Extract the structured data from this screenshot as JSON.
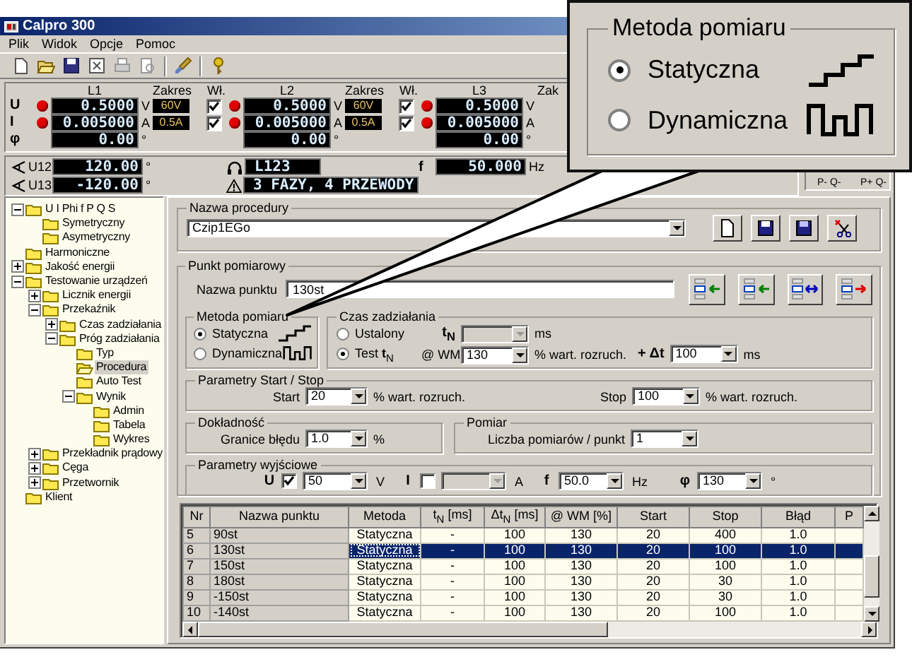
{
  "window": {
    "title": "Calpro 300"
  },
  "menu": [
    "Plik",
    "Widok",
    "Opcje",
    "Pomoc"
  ],
  "readings": {
    "row_labels": [
      "U",
      "I",
      "φ"
    ],
    "phases": [
      {
        "label": "L1",
        "range_heading": "Zakres",
        "enable_heading": "Wł.",
        "rows": [
          {
            "led": true,
            "value": "0.5000",
            "unit": "V",
            "range": "60V",
            "enabled": true
          },
          {
            "led": true,
            "value": "0.005000",
            "unit": "A",
            "range": "0.5A",
            "enabled": true
          },
          {
            "led": false,
            "value": "0.00",
            "unit": "°"
          }
        ]
      },
      {
        "label": "L2",
        "range_heading": "Zakres",
        "enable_heading": "Wł.",
        "rows": [
          {
            "led": true,
            "value": "0.5000",
            "unit": "V",
            "range": "60V",
            "enabled": true
          },
          {
            "led": true,
            "value": "0.005000",
            "unit": "A",
            "range": "0.5A",
            "enabled": true
          },
          {
            "led": false,
            "value": "0.00",
            "unit": "°"
          }
        ]
      },
      {
        "label": "L3",
        "range_heading": "Zak",
        "rows": [
          {
            "led": true,
            "value": "0.5000",
            "unit": "V"
          },
          {
            "led": true,
            "value": "0.005000",
            "unit": "A"
          },
          {
            "led": false,
            "value": "0.00",
            "unit": "°"
          }
        ]
      }
    ]
  },
  "angles": [
    {
      "label": "U12",
      "value": "120.00",
      "unit": "°"
    },
    {
      "label": "U13",
      "value": "-120.00",
      "unit": "°"
    }
  ],
  "sequence": {
    "value": "L123"
  },
  "wiring": {
    "value": "3 FAZY, 4 PRZEWODY"
  },
  "frequency": {
    "label": "f",
    "value": "50.000",
    "unit": "Hz"
  },
  "quadrants": [
    "P- Q-",
    "P+ Q-"
  ],
  "tree": [
    {
      "label": "U I Phi f P Q S",
      "expanded": true,
      "selected": false,
      "children": [
        {
          "label": "Symetryczny",
          "selected": false
        },
        {
          "label": "Asymetryczny",
          "selected": false
        }
      ]
    },
    {
      "label": "Harmoniczne",
      "selected": false
    },
    {
      "label": "Jakość energii",
      "expanded": false,
      "selected": false
    },
    {
      "label": "Testowanie urządzeń",
      "expanded": true,
      "selected": false,
      "children": [
        {
          "label": "Licznik energii",
          "expanded": false,
          "selected": false
        },
        {
          "label": "Przekaźnik",
          "expanded": true,
          "selected": false,
          "children": [
            {
              "label": "Czas zadziałania",
              "expanded": false,
              "selected": false
            },
            {
              "label": "Próg zadziałania",
              "expanded": true,
              "selected": false,
              "children": [
                {
                  "label": "Typ",
                  "selected": false
                },
                {
                  "label": "Procedura",
                  "selected": true
                },
                {
                  "label": "Auto Test",
                  "selected": false
                },
                {
                  "label": "Wynik",
                  "expanded": true,
                  "selected": false,
                  "children": [
                    {
                      "label": "Admin",
                      "selected": false
                    },
                    {
                      "label": "Tabela",
                      "selected": false
                    },
                    {
                      "label": "Wykres",
                      "selected": false
                    }
                  ]
                }
              ]
            }
          ]
        },
        {
          "label": "Przekładnik prądowy",
          "expanded": false,
          "selected": false
        },
        {
          "label": "Cęga",
          "expanded": false,
          "selected": false
        },
        {
          "label": "Przetwornik",
          "expanded": false,
          "selected": false
        }
      ]
    },
    {
      "label": "Klient",
      "selected": false
    }
  ],
  "procedure": {
    "title": "Nazwa procedury",
    "name": "Czip1EGo"
  },
  "point": {
    "title": "Punkt pomiarowy",
    "name_label": "Nazwa punktu",
    "name": "130st",
    "method": {
      "title": "Metoda pomiaru",
      "options": [
        {
          "label": "Statyczna",
          "kind": "static",
          "selected": true
        },
        {
          "label": "Dynamiczna",
          "kind": "dynamic",
          "selected": false
        }
      ]
    },
    "timing": {
      "title": "Czas zadziałania",
      "fixed": {
        "label": "Ustalony",
        "selected": false,
        "field_label": "t$_{N}$",
        "disabled": true,
        "unit": "ms"
      },
      "test": {
        "label": "Test **t**$_{N}$",
        "selected": true,
        "field_label": "@ WM",
        "value": "130",
        "unit": "% wart. rozruch."
      },
      "delta": {
        "label": "+ Δt",
        "value": "100",
        "unit": "ms"
      }
    },
    "start_stop": {
      "title": "Parametry Start / Stop",
      "start": {
        "label": "Start",
        "value": "20",
        "unit": "% wart. rozruch."
      },
      "stop": {
        "label": "Stop",
        "value": "100",
        "unit": "% wart. rozruch."
      }
    },
    "accuracy": {
      "title": "Dokładność",
      "label": "Granice błędu",
      "value": "1.0",
      "unit": "%"
    },
    "measurement": {
      "title": "Pomiar",
      "label": "Liczba pomiarów / punkt",
      "value": "1"
    },
    "outputs": {
      "title": "Parametry wyjściowe",
      "items": [
        {
          "kind": "toggle",
          "label": "U",
          "checked": true,
          "value": "50",
          "unit": "V"
        },
        {
          "kind": "toggle",
          "label": "I",
          "checked": false,
          "disabled": true,
          "unit": "A"
        },
        {
          "kind": "plain",
          "label": "f",
          "value": "50.0",
          "unit": "Hz"
        },
        {
          "kind": "plain",
          "label": "φ",
          "value": "130",
          "unit": "°"
        }
      ]
    }
  },
  "table": {
    "columns": [
      "Nr",
      "Nazwa punktu",
      "Metoda",
      "t$_{N}$ [ms]",
      "Δt$_{N}$ [ms]",
      "@ WM [%]",
      "Start",
      "Stop",
      "Błąd",
      "P"
    ],
    "rows": [
      {
        "selected": false,
        "cells": [
          "5",
          "90st",
          "Statyczna",
          "-",
          "100",
          "130",
          "20",
          "400",
          "1.0"
        ]
      },
      {
        "selected": true,
        "cells": [
          "6",
          "130st",
          "Statyczna",
          "-",
          "100",
          "130",
          "20",
          "100",
          "1.0"
        ]
      },
      {
        "selected": false,
        "cells": [
          "7",
          "150st",
          "Statyczna",
          "-",
          "100",
          "130",
          "20",
          "100",
          "1.0"
        ]
      },
      {
        "selected": false,
        "cells": [
          "8",
          "180st",
          "Statyczna",
          "-",
          "100",
          "130",
          "20",
          "30",
          "1.0"
        ]
      },
      {
        "selected": false,
        "cells": [
          "9",
          "-150st",
          "Statyczna",
          "-",
          "100",
          "130",
          "20",
          "30",
          "1.0"
        ]
      },
      {
        "selected": false,
        "cells": [
          "10",
          "-140st",
          "Statyczna",
          "-",
          "100",
          "130",
          "20",
          "100",
          "1.0"
        ]
      }
    ]
  },
  "callout": {
    "title": "Metoda pomiaru",
    "options": [
      {
        "label": "Statyczna",
        "kind": "static",
        "selected": true
      },
      {
        "label": "Dynamiczna",
        "kind": "dynamic",
        "selected": false
      }
    ]
  }
}
